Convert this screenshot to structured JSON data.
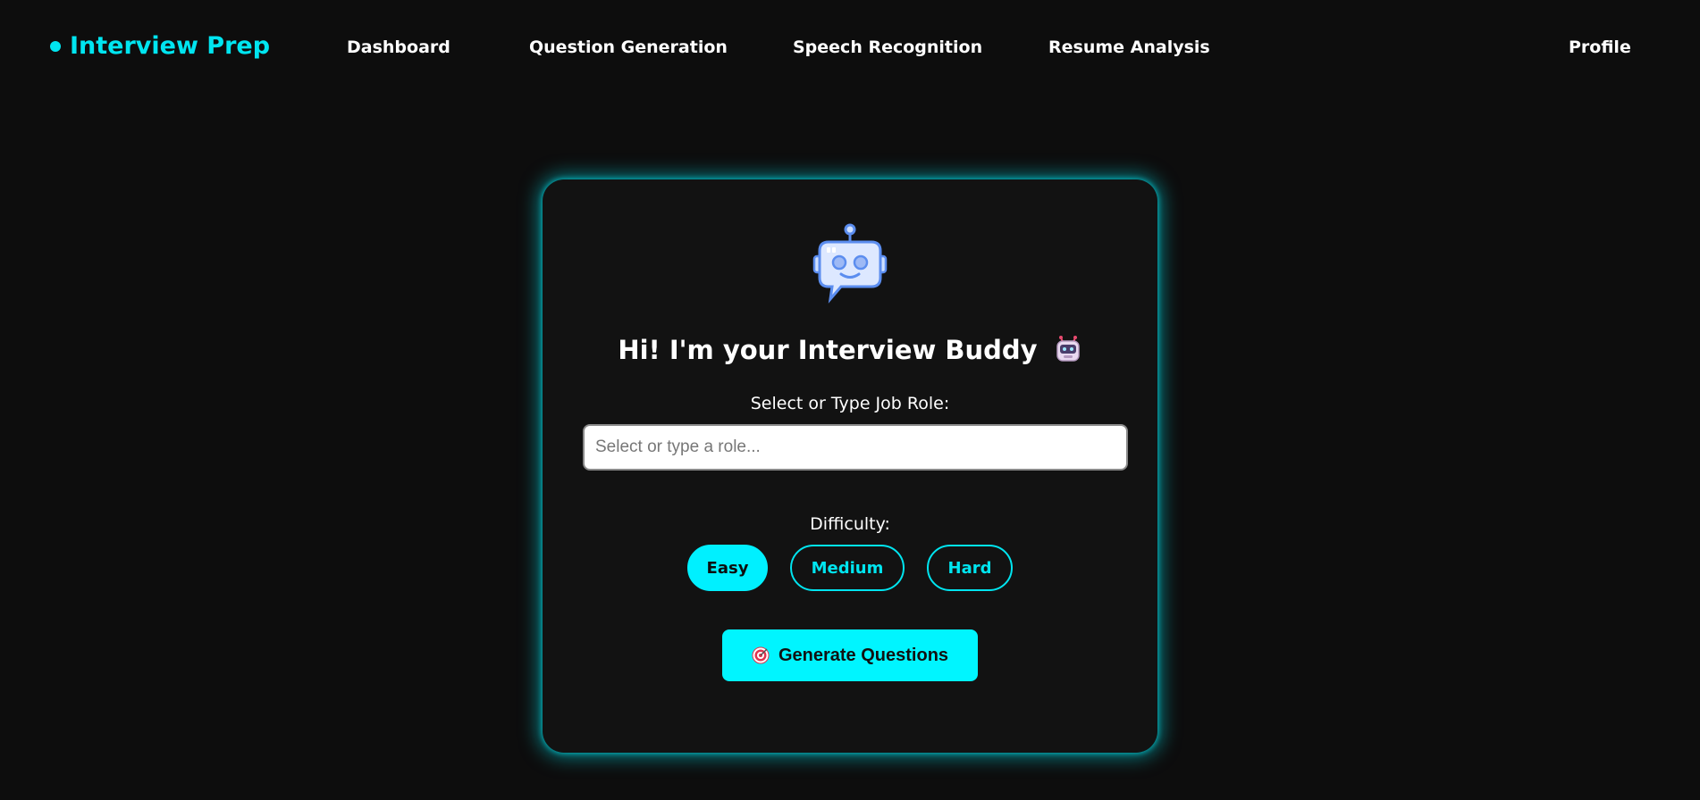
{
  "nav": {
    "brand": "Interview Prep",
    "links": [
      "Dashboard",
      "Question Generation",
      "Speech Recognition",
      "Resume Analysis"
    ],
    "profile": "Profile"
  },
  "card": {
    "icon": "robot-chat-icon",
    "title": "Hi! I'm your Interview Buddy",
    "title_icon": "robot-face-icon",
    "role_label": "Select or Type Job Role:",
    "role_placeholder": "Select or type a role...",
    "role_value": "",
    "difficulty_label": "Difficulty:",
    "difficulties": [
      "Easy",
      "Medium",
      "Hard"
    ],
    "selected_difficulty": "Easy",
    "generate_icon": "target-icon",
    "generate_label": "Generate Questions"
  },
  "colors": {
    "accent": "#00e5f0",
    "background": "#0d0d0d",
    "card": "#121212"
  }
}
